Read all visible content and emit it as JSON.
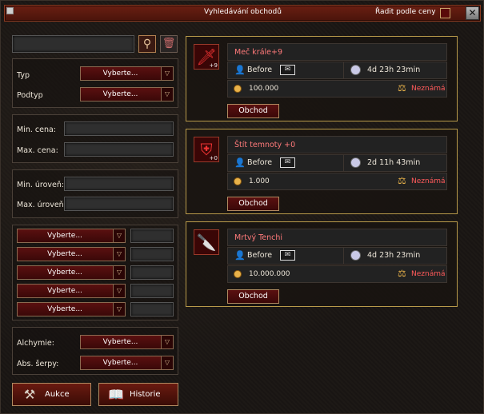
{
  "window": {
    "title": "Vyhledávání obchodů",
    "sort_label": "Řadit podle ceny",
    "close_glyph": "✕"
  },
  "filters": {
    "search_value": "",
    "type_label": "Typ",
    "type_value": "Vyberte...",
    "subtype_label": "Podtyp",
    "subtype_value": "Vyberte...",
    "min_price_label": "Min. cena:",
    "max_price_label": "Max. cena:",
    "min_level_label": "Min. úroveň:",
    "max_level_label": "Max. úroveň:",
    "bonus_selects": [
      "Vyberte...",
      "Vyberte...",
      "Vyberte...",
      "Vyberte...",
      "Vyberte..."
    ],
    "alchemy_label": "Alchymie:",
    "alchemy_value": "Vyberte...",
    "sash_label": "Abs. šerpy:",
    "sash_value": "Vyberte...",
    "auction_label": "Aukce",
    "history_label": "Historie"
  },
  "results": [
    {
      "name": "Meč krále+9",
      "level_badge": "+9",
      "icon": "sword-icon",
      "seller": "Before",
      "time_left": "4d 23h 23min",
      "price": "100.000",
      "status": "Neznámá",
      "action": "Obchod"
    },
    {
      "name": "Štít temnoty +0",
      "level_badge": "+0",
      "icon": "shield-icon",
      "seller": "Before",
      "time_left": "2d 11h 43min",
      "price": "1.000",
      "status": "Neznámá",
      "action": "Obchod"
    },
    {
      "name": "Mrtvý Tenchi",
      "level_badge": "",
      "icon": "dagger-icon",
      "seller": "Before",
      "time_left": "4d 23h 23min",
      "price": "10.000.000",
      "status": "Neznámá",
      "action": "Obchod"
    }
  ],
  "colors": {
    "accent_gold": "#b89a4a",
    "item_name_red": "#ff7a7a",
    "status_red": "#ff5a5a",
    "button_red": "#5a1010"
  }
}
